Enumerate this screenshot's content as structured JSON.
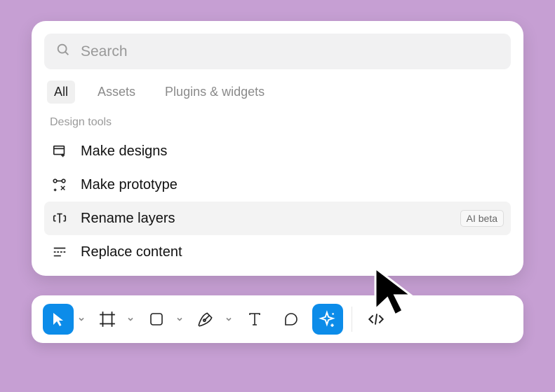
{
  "search": {
    "placeholder": "Search"
  },
  "tabs": {
    "all": "All",
    "assets": "Assets",
    "plugins": "Plugins & widgets"
  },
  "section": {
    "header": "Design tools",
    "items": [
      {
        "label": "Make designs"
      },
      {
        "label": "Make prototype"
      },
      {
        "label": "Rename layers",
        "badge": "AI beta"
      },
      {
        "label": "Replace content"
      }
    ]
  },
  "toolbar": {
    "move": "Move",
    "frame": "Frame",
    "shape": "Rectangle",
    "pen": "Pen",
    "text": "Text",
    "comment": "Comment",
    "ai": "AI",
    "dev": "Dev Mode"
  }
}
